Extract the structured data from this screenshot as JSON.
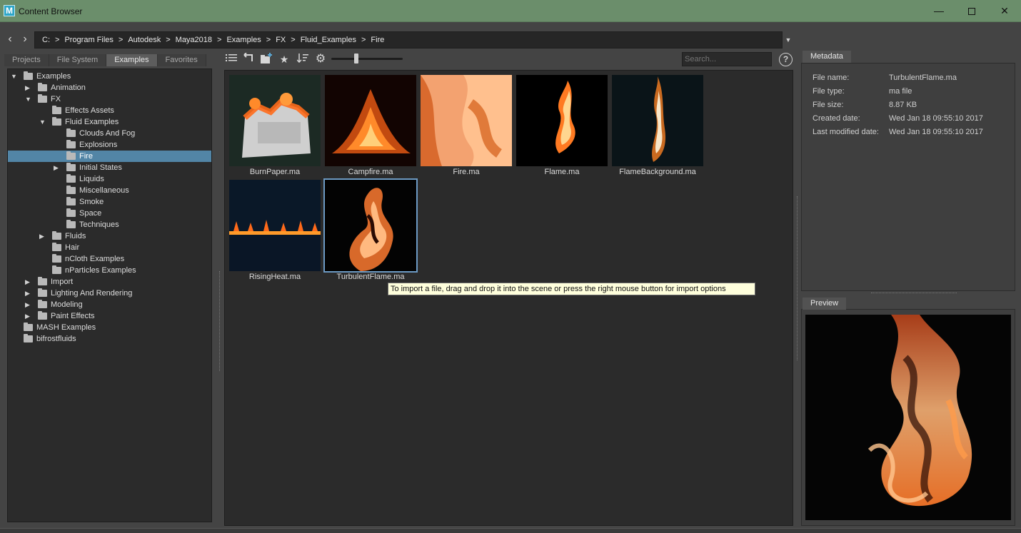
{
  "window": {
    "title": "Content Browser",
    "app_icon_letter": "M",
    "minimize": "—",
    "close": "✕"
  },
  "address": {
    "back_icon": "‹",
    "forward_icon": "›",
    "drive": "C:",
    "crumbs": [
      "Program Files",
      "Autodesk",
      "Maya2018",
      "Examples",
      "FX",
      "Fluid_Examples",
      "Fire"
    ],
    "separator": ">",
    "dropdown_icon": "▼"
  },
  "tabs": [
    "Projects",
    "File System",
    "Examples",
    "Favorites"
  ],
  "active_tab": "Examples",
  "tree": [
    {
      "label": "Examples",
      "depth": 0,
      "expander": "open"
    },
    {
      "label": "Animation",
      "depth": 1,
      "expander": "closed"
    },
    {
      "label": "FX",
      "depth": 1,
      "expander": "open"
    },
    {
      "label": "Effects Assets",
      "depth": 2,
      "expander": "none"
    },
    {
      "label": "Fluid Examples",
      "depth": 2,
      "expander": "open"
    },
    {
      "label": "Clouds And Fog",
      "depth": 3,
      "expander": "none"
    },
    {
      "label": "Explosions",
      "depth": 3,
      "expander": "none"
    },
    {
      "label": "Fire",
      "depth": 3,
      "expander": "none",
      "selected": true
    },
    {
      "label": "Initial States",
      "depth": 3,
      "expander": "closed"
    },
    {
      "label": "Liquids",
      "depth": 3,
      "expander": "none"
    },
    {
      "label": "Miscellaneous",
      "depth": 3,
      "expander": "none"
    },
    {
      "label": "Smoke",
      "depth": 3,
      "expander": "none"
    },
    {
      "label": "Space",
      "depth": 3,
      "expander": "none"
    },
    {
      "label": "Techniques",
      "depth": 3,
      "expander": "none"
    },
    {
      "label": "Fluids",
      "depth": 2,
      "expander": "closed"
    },
    {
      "label": "Hair",
      "depth": 2,
      "expander": "none"
    },
    {
      "label": "nCloth Examples",
      "depth": 2,
      "expander": "none"
    },
    {
      "label": "nParticles Examples",
      "depth": 2,
      "expander": "none"
    },
    {
      "label": "Import",
      "depth": 1,
      "expander": "closed"
    },
    {
      "label": "Lighting And Rendering",
      "depth": 1,
      "expander": "closed"
    },
    {
      "label": "Modeling",
      "depth": 1,
      "expander": "closed"
    },
    {
      "label": "Paint Effects",
      "depth": 1,
      "expander": "closed"
    },
    {
      "label": "MASH Examples",
      "depth": 0,
      "expander": "none"
    },
    {
      "label": "bifrostfluids",
      "depth": 0,
      "expander": "none"
    }
  ],
  "toolbar": {
    "list_view_icon": "list-view-icon",
    "up_folder_icon": "up-folder-icon",
    "new_folder_icon": "new-folder-icon",
    "favorite_icon": "star-icon",
    "sort_icon": "sort-icon",
    "settings_icon": "gear-icon",
    "thumbnail_size": 0.35,
    "search_placeholder": "Search...",
    "help": "?"
  },
  "files": [
    {
      "name": "BurnPaper.ma",
      "art": "burnpaper"
    },
    {
      "name": "Campfire.ma",
      "art": "campfire"
    },
    {
      "name": "Fire.ma",
      "art": "fire"
    },
    {
      "name": "Flame.ma",
      "art": "flame"
    },
    {
      "name": "FlameBackground.ma",
      "art": "flamebg"
    },
    {
      "name": "RisingHeat.ma",
      "art": "risingheat"
    },
    {
      "name": "TurbulentFlame.ma",
      "art": "turbulent",
      "selected": true
    }
  ],
  "tooltip": "To import a file, drag and drop it into the scene or press the right mouse button for import options",
  "metadata": {
    "tab": "Metadata",
    "rows": [
      {
        "key": "File name:",
        "value": "TurbulentFlame.ma"
      },
      {
        "key": "File type:",
        "value": "ma file"
      },
      {
        "key": "File size:",
        "value": "8.87 KB"
      },
      {
        "key": "Created date:",
        "value": "Wed Jan 18 09:55:10 2017"
      },
      {
        "key": "Last modified date:",
        "value": "Wed Jan 18 09:55:10 2017"
      }
    ]
  },
  "preview": {
    "tab": "Preview"
  },
  "colors": {
    "title_bar": "#6b8e6b",
    "selection": "#5285a6",
    "panel_bg": "#2b2b2b",
    "window_bg": "#444444",
    "tooltip_bg": "#ffffdc"
  }
}
